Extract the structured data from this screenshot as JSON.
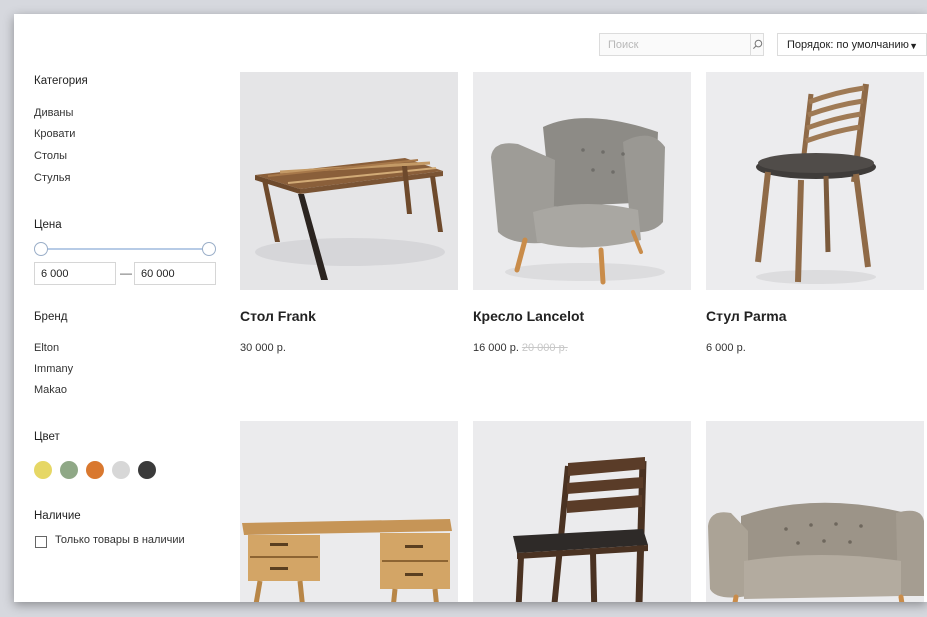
{
  "topbar": {
    "search_placeholder": "Поиск",
    "sort_label": "Порядок: по умолчанию"
  },
  "sidebar": {
    "category_heading": "Категория",
    "categories": [
      "Диваны",
      "Кровати",
      "Столы",
      "Стулья"
    ],
    "price_heading": "Цена",
    "price_min": "6 000",
    "price_dash": "—",
    "price_max": "60 000",
    "brand_heading": "Бренд",
    "brands": [
      "Elton",
      "Immany",
      "Makao"
    ],
    "color_heading": "Цвет",
    "colors": [
      "#e6d765",
      "#8fa886",
      "#d9782f",
      "#d7d7d7",
      "#3a3a3a"
    ],
    "availability_heading": "Наличие",
    "availability_label": "Только товары в наличии",
    "availability_checked": false
  },
  "products": [
    {
      "name": "Стол Frank",
      "price": "30 000 р.",
      "old_price": ""
    },
    {
      "name": "Кресло Lancelot",
      "price": "16 000 р.",
      "old_price": "20 000 р."
    },
    {
      "name": "Стул Parma",
      "price": "6 000 р.",
      "old_price": ""
    },
    {
      "name": "",
      "price": "",
      "old_price": ""
    },
    {
      "name": "",
      "price": "",
      "old_price": ""
    },
    {
      "name": "",
      "price": "",
      "old_price": ""
    }
  ]
}
